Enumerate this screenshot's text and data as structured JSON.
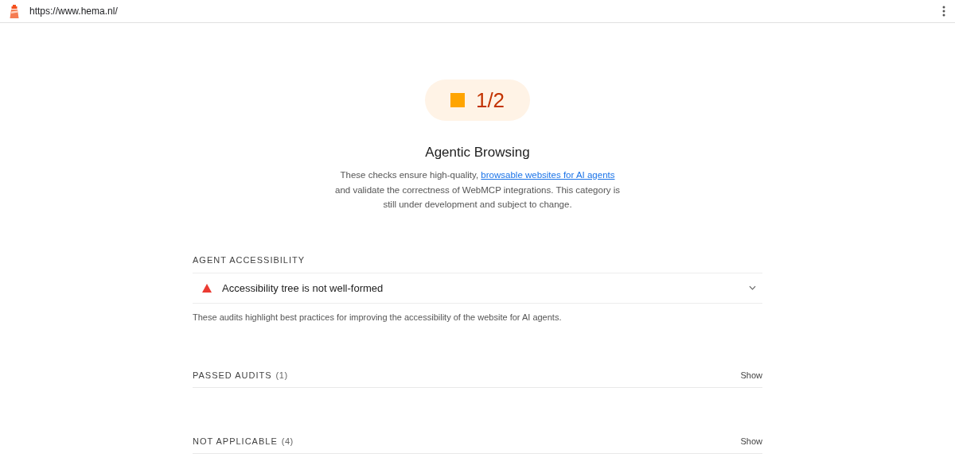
{
  "toolbar": {
    "url": "https://www.hema.nl/"
  },
  "score": {
    "text": "1/2",
    "kind": "average"
  },
  "category": {
    "title": "Agentic Browsing",
    "description": {
      "before": "These checks ensure high-quality, ",
      "link": "browsable websites for AI agents",
      "after": " and validate the correctness of WebMCP integrations. This category is still under development and subject to change."
    }
  },
  "group": {
    "title": "AGENT ACCESSIBILITY",
    "audits": [
      {
        "title": "Accessibility tree is not well-formed",
        "kind": "fail",
        "expanded": false
      }
    ],
    "description": "These audits highlight best practices for improving the accessibility of the website for AI agents."
  },
  "collapsed_groups": [
    {
      "title": "PASSED AUDITS",
      "count": "(1)",
      "toggle": "Show"
    },
    {
      "title": "NOT APPLICABLE",
      "count": "(4)",
      "toggle": "Show"
    }
  ]
}
